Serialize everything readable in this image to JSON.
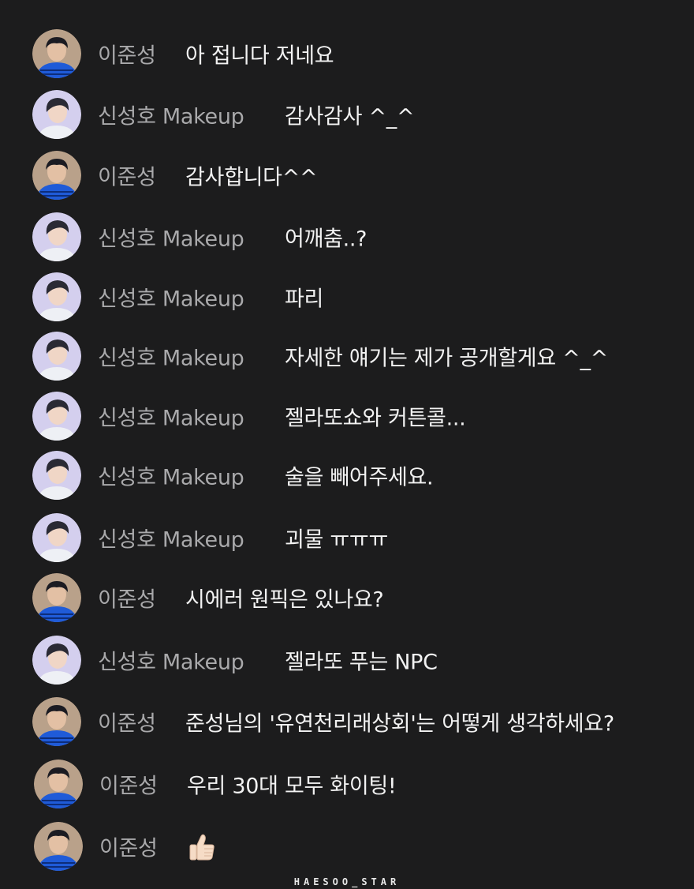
{
  "messages": [
    {
      "author": "이준성",
      "text": "아 접니다 저네요",
      "avatar": "user-a"
    },
    {
      "author": "신성호 Makeup",
      "text": "감사감사 ^_^",
      "avatar": "user-b"
    },
    {
      "author": "이준성",
      "text": "감사합니다^^",
      "avatar": "user-a"
    },
    {
      "author": "신성호 Makeup",
      "text": "어깨춤..?",
      "avatar": "user-b"
    },
    {
      "author": "신성호 Makeup",
      "text": "파리",
      "avatar": "user-b"
    },
    {
      "author": "신성호 Makeup",
      "text": "자세한 얘기는 제가 공개할게요 ^_^",
      "avatar": "user-b"
    },
    {
      "author": "신성호 Makeup",
      "text": "젤라또쇼와 커튼콜...",
      "avatar": "user-b"
    },
    {
      "author": "신성호 Makeup",
      "text": "술을 빼어주세요.",
      "avatar": "user-b"
    },
    {
      "author": "신성호 Makeup",
      "text": "괴물 ㅠㅠㅠ",
      "avatar": "user-b"
    },
    {
      "author": "이준성",
      "text": "시에러 원픽은 있나요?",
      "avatar": "user-a"
    },
    {
      "author": "신성호 Makeup",
      "text": "젤라또 푸는 NPC",
      "avatar": "user-b"
    },
    {
      "author": "이준성",
      "text": "준성님의 '유연천리래상회'는 어떻게 생각하세요?",
      "avatar": "user-a"
    },
    {
      "author": "이준성",
      "text": "우리 30대 모두 화이팅!",
      "avatar": "user-a"
    },
    {
      "author": "이준성",
      "text": "",
      "emoji": "thumbs-up-icon",
      "avatar": "user-a"
    }
  ],
  "watermark": "HAESOO_STAR",
  "colors": {
    "background": "#1c1c1d",
    "author": "#a9a9ab",
    "message": "#f2f2f2"
  }
}
